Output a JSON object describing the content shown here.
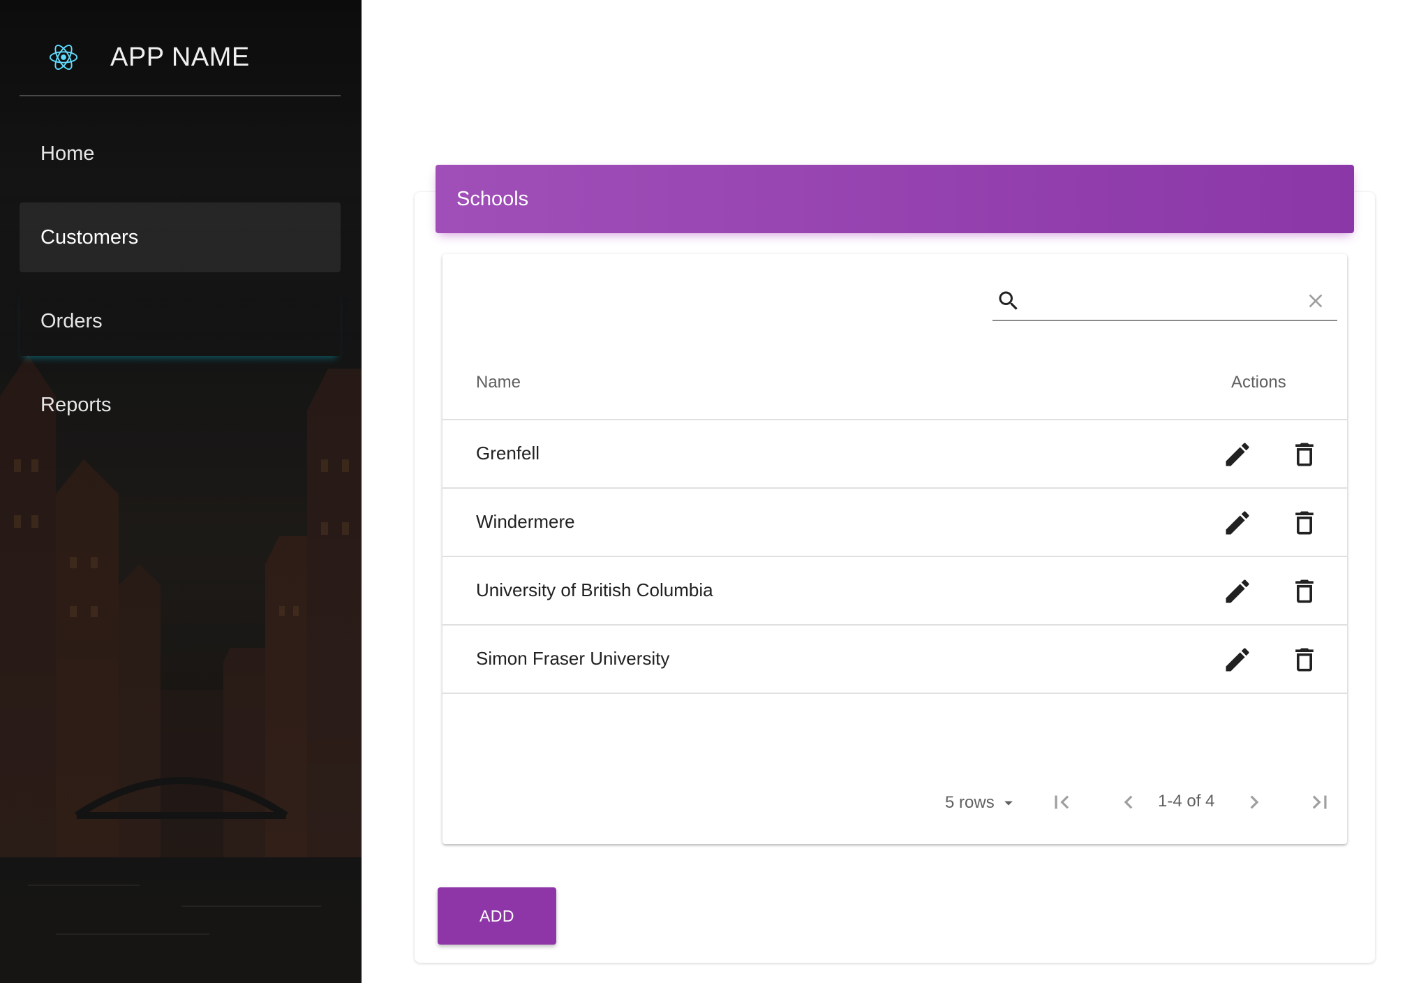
{
  "sidebar": {
    "app_name": "APP NAME",
    "logo_icon": "react-atom-icon",
    "items": [
      {
        "label": "Home",
        "active": false
      },
      {
        "label": "Customers",
        "active": true
      },
      {
        "label": "Orders",
        "active": false
      },
      {
        "label": "Reports",
        "active": false
      }
    ]
  },
  "card": {
    "title": "Schools",
    "header_gradient": [
      "#a04fb8",
      "#8b37a8"
    ]
  },
  "search": {
    "placeholder": "",
    "value": "",
    "search_icon": "search-icon",
    "clear_icon": "close-icon"
  },
  "table": {
    "columns": {
      "name": "Name",
      "actions": "Actions"
    },
    "rows": [
      {
        "name": "Grenfell"
      },
      {
        "name": "Windermere"
      },
      {
        "name": "University of British Columbia"
      },
      {
        "name": "Simon Fraser University"
      }
    ],
    "row_actions": [
      "edit-icon",
      "delete-icon"
    ]
  },
  "pagination": {
    "rows_per_page": "5 rows",
    "page_info": "1-4 of 4"
  },
  "add_button": {
    "label": "ADD"
  },
  "colors": {
    "accent": "#8e35a8",
    "sidebar_bg": "#1f1f1f"
  }
}
